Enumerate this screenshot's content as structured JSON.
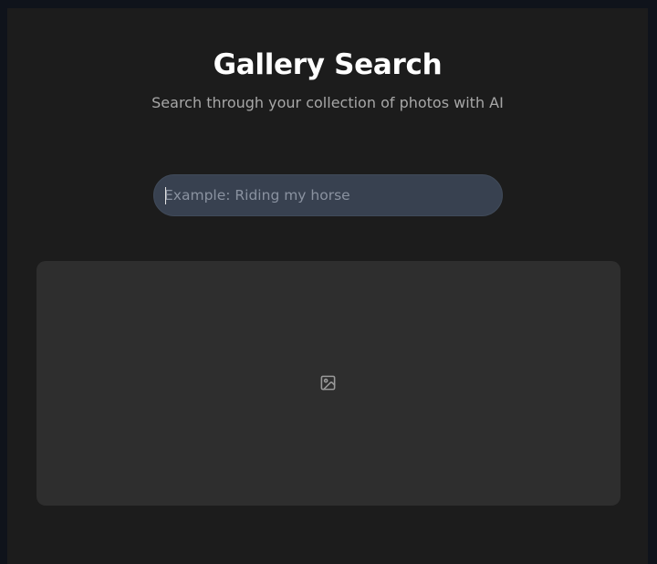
{
  "header": {
    "title": "Gallery Search",
    "subtitle": "Search through your collection of photos with AI"
  },
  "search": {
    "value": "",
    "placeholder": "Example: Riding my horse"
  },
  "result": {
    "icon": "image-icon"
  },
  "colors": {
    "page_background": "#0f131b",
    "panel_background": "#1c1c1c",
    "input_background": "#384150",
    "image_area_background": "#2e2e2e"
  }
}
